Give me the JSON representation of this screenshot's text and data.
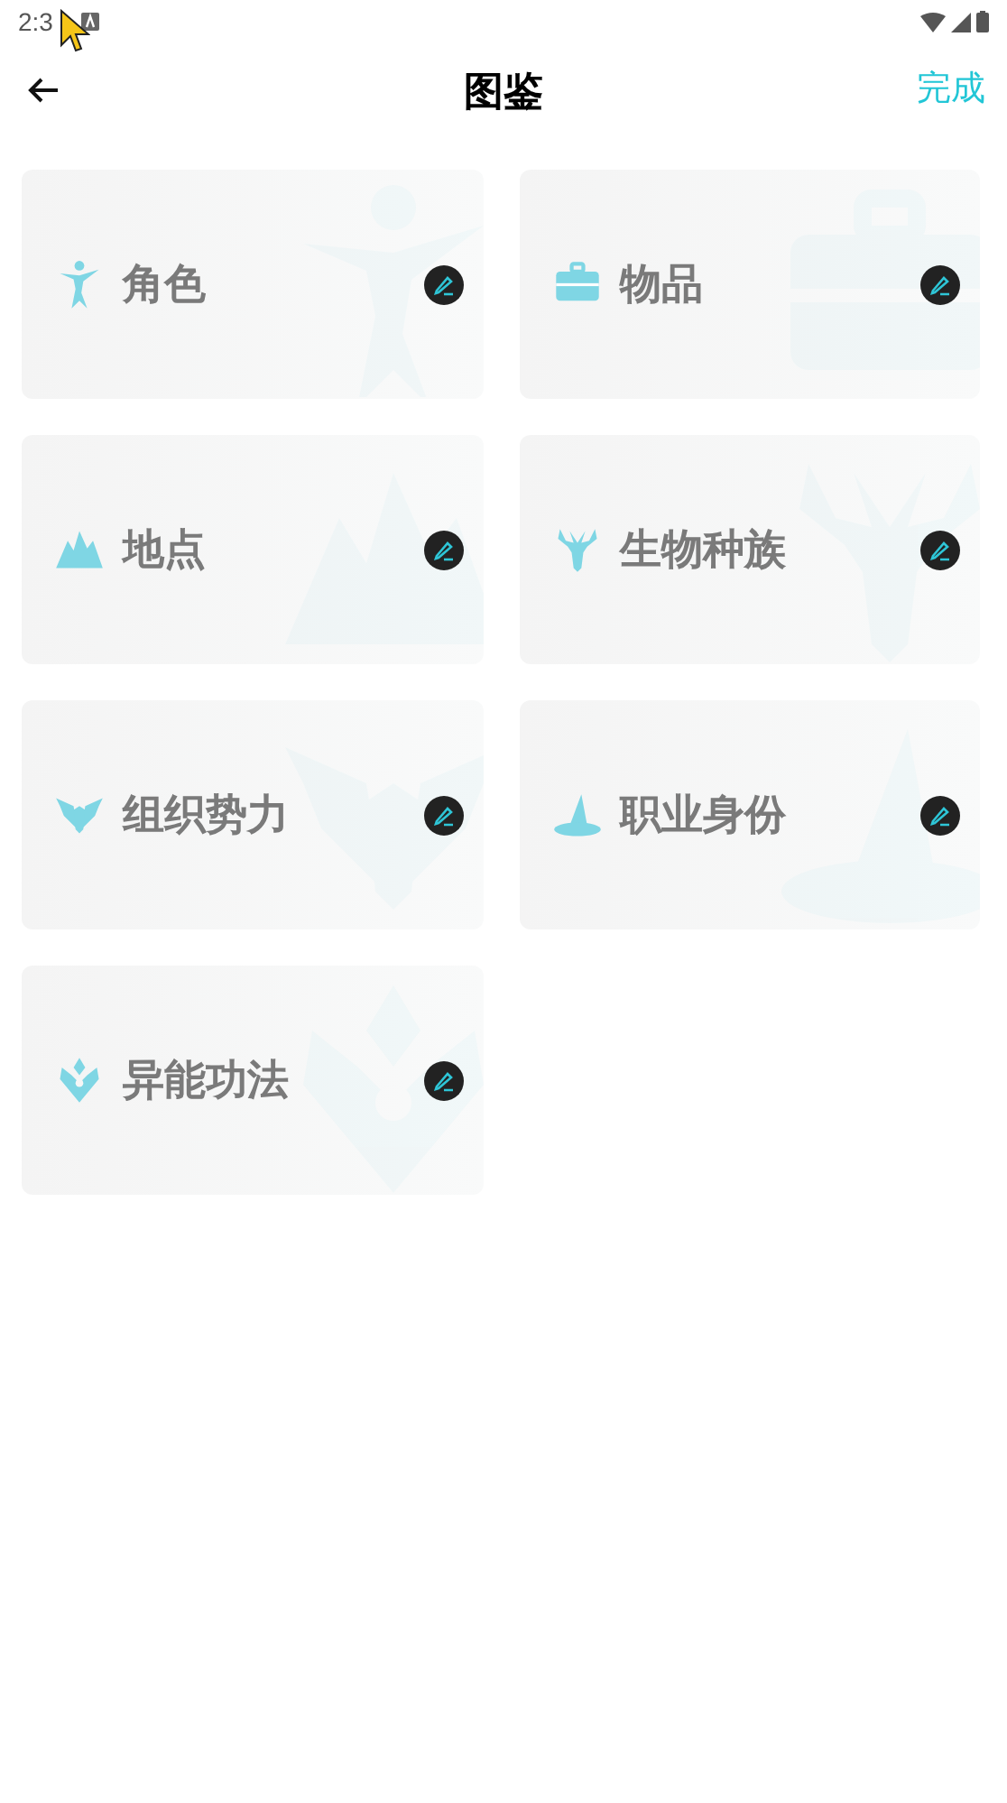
{
  "status_bar": {
    "time": "2:3"
  },
  "header": {
    "title": "图鉴",
    "done": "完成"
  },
  "categories": [
    {
      "label": "角色"
    },
    {
      "label": "物品"
    },
    {
      "label": "地点"
    },
    {
      "label": "生物种族"
    },
    {
      "label": "组织势力"
    },
    {
      "label": "职业身份"
    },
    {
      "label": "异能功法"
    }
  ]
}
